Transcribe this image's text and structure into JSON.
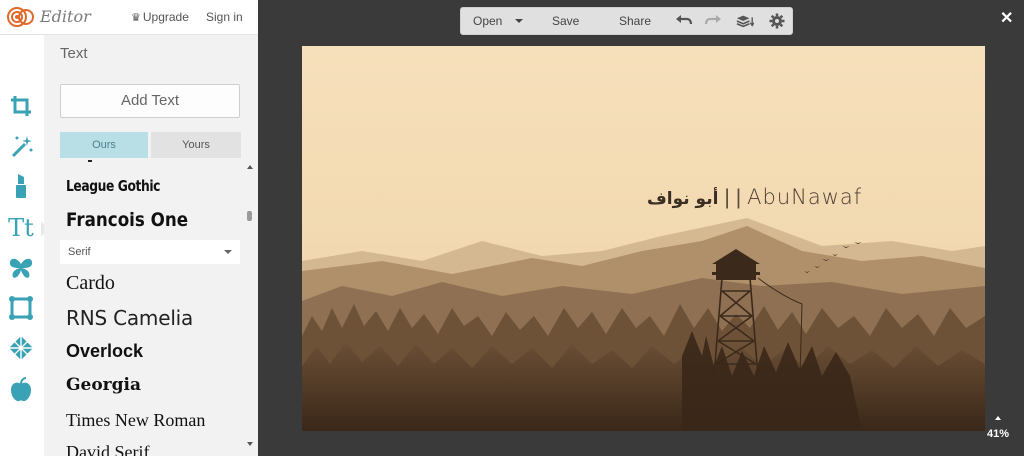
{
  "header": {
    "brand": "Editor",
    "upgrade": "Upgrade",
    "signin": "Sign in"
  },
  "tools": [
    {
      "name": "crop-icon"
    },
    {
      "name": "magic-wand-icon"
    },
    {
      "name": "lipstick-icon"
    },
    {
      "name": "text-icon",
      "glyph": "Tt"
    },
    {
      "name": "butterfly-icon"
    },
    {
      "name": "frame-icon"
    },
    {
      "name": "texture-icon"
    },
    {
      "name": "apple-icon"
    }
  ],
  "panel": {
    "title": "Text",
    "add_button": "Add Text",
    "tabs": {
      "ours": "Ours",
      "yours": "Yours"
    },
    "category": "Serif",
    "fonts_top": [
      "League Gothic",
      "Francois One"
    ],
    "fonts_serif": [
      "Cardo",
      "RNS Camelia",
      "Overlock",
      "Georgia",
      "Times New Roman"
    ],
    "partial_next": "David Serif"
  },
  "toolbar": {
    "open": "Open",
    "save": "Save",
    "share": "Share"
  },
  "canvas": {
    "arabic_text": "أبو نواف",
    "separator": "| |",
    "english_text": "AbuNawaf"
  },
  "zoom": "41%",
  "colors": {
    "tab_active": "#b8dfe6",
    "accent_icon": "#3aa2b5",
    "sky": "#f5dfba",
    "ground": "#3d2a1a"
  }
}
